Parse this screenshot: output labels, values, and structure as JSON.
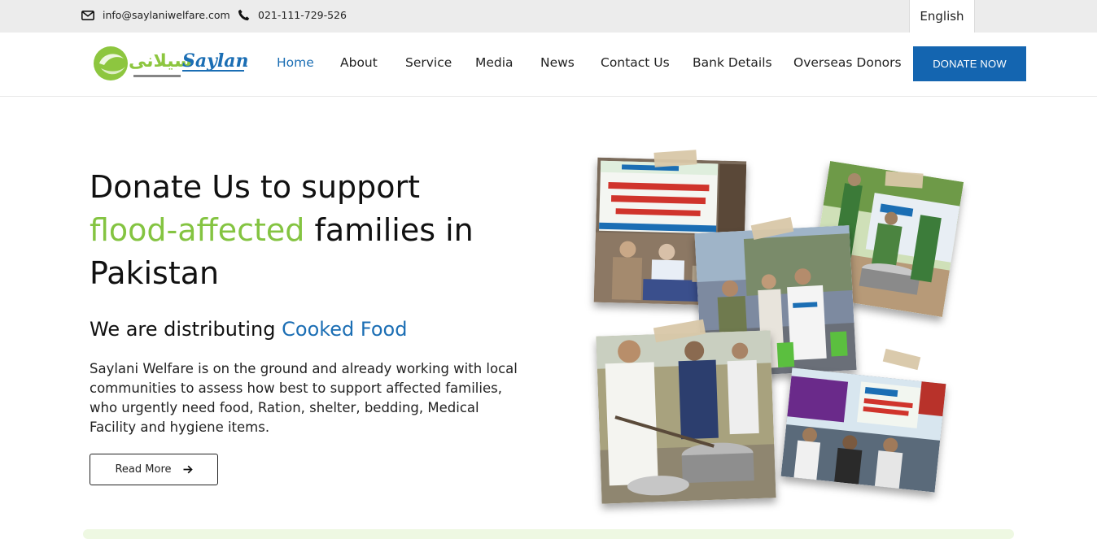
{
  "topbar": {
    "email": "info@saylaniwelfare.com",
    "phone": "021-111-729-526",
    "language": "English"
  },
  "header": {
    "logo_text": "Saylani",
    "logo_urdu": "سیلانی",
    "nav": [
      "Home",
      "About",
      "Service",
      "Media",
      "News",
      "Contact Us",
      "Bank Details",
      "Overseas Donors"
    ],
    "active_nav": "Home",
    "donate_label": "DONATE NOW"
  },
  "hero": {
    "title_part1": "Donate Us to support",
    "title_highlight": "flood-affected",
    "title_part2": "families in",
    "title_part3": "Pakistan",
    "subtitle_prefix": "We are distributing",
    "subtitle_highlight": "Cooked Food",
    "description": "Saylani Welfare is on the ground and already working with local communities to assess how best to support affected families, who urgently need food, Ration, shelter, bedding, Medical Facility and hygiene items.",
    "read_more_label": "Read More"
  },
  "colors": {
    "brand_blue": "#1465b0",
    "brand_green": "#84c441",
    "topbar_bg": "#ececec"
  },
  "icons": [
    "envelope-icon",
    "phone-icon",
    "arrow-right-icon"
  ]
}
